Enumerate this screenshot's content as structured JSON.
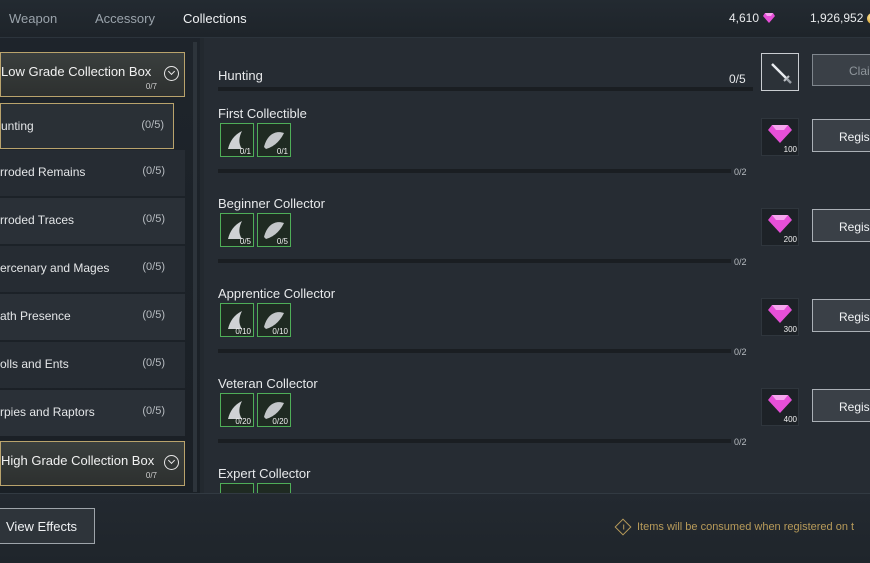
{
  "tabs": [
    {
      "label": "Weapon"
    },
    {
      "label": "Accessory"
    },
    {
      "label": "Collections"
    }
  ],
  "active_tab": "Collections",
  "currency": {
    "gems": "4,610",
    "gold": "1,926,952"
  },
  "colors": {
    "accent_gold": "#b9a36c",
    "slot_green": "#4fae58",
    "gem_pink": "#e64fd8",
    "notice_text": "#b89b5a"
  },
  "left_panel": {
    "low_box": {
      "title": "Low Grade Collection Box",
      "count": "0/7"
    },
    "categories": [
      {
        "label": "unting",
        "count": "(0/5)"
      },
      {
        "label": "rroded Remains",
        "count": "(0/5)"
      },
      {
        "label": "rroded Traces",
        "count": "(0/5)"
      },
      {
        "label": "ercenary and Mages",
        "count": "(0/5)"
      },
      {
        "label": "ath Presence",
        "count": "(0/5)"
      },
      {
        "label": "olls and Ents",
        "count": "(0/5)"
      },
      {
        "label": "rpies and Raptors",
        "count": "(0/5)"
      }
    ],
    "high_box": {
      "title": "High Grade Collection Box",
      "count": "0/7"
    }
  },
  "main": {
    "header": {
      "title": "Hunting",
      "count": "0/5",
      "claim_label": "Clai"
    },
    "achievements": [
      {
        "name": "First Collectible",
        "item1": "0/1",
        "item2": "0/1",
        "progress": "0/2",
        "reward": "100",
        "button": "Regis"
      },
      {
        "name": "Beginner Collector",
        "item1": "0/5",
        "item2": "0/5",
        "progress": "0/2",
        "reward": "200",
        "button": "Regis"
      },
      {
        "name": "Apprentice Collector",
        "item1": "0/10",
        "item2": "0/10",
        "progress": "0/2",
        "reward": "300",
        "button": "Regis"
      },
      {
        "name": "Veteran Collector",
        "item1": "0/20",
        "item2": "0/20",
        "progress": "0/2",
        "reward": "400",
        "button": "Regis"
      },
      {
        "name": "Expert Collector"
      }
    ]
  },
  "bottom": {
    "view_effects": "View Effects",
    "notice": "Items will be consumed when registered on t"
  }
}
